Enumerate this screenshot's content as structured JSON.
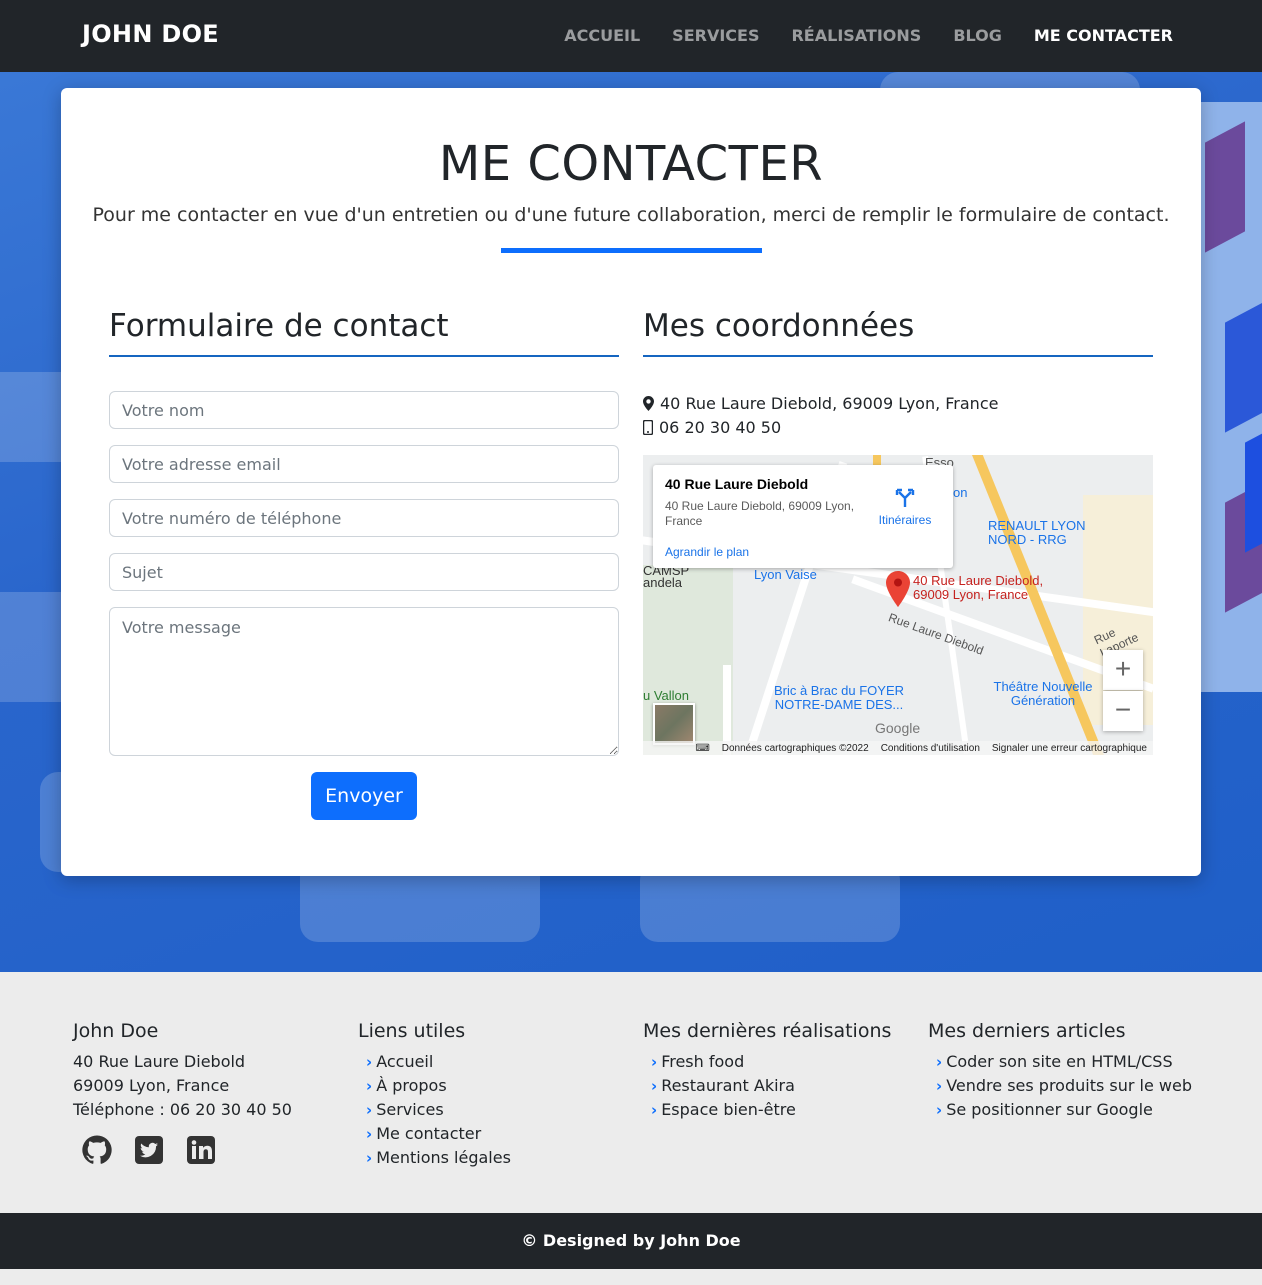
{
  "nav": {
    "brand": "JOHN DOE",
    "links": [
      "ACCUEIL",
      "SERVICES",
      "RÉALISATIONS",
      "BLOG",
      "ME CONTACTER"
    ]
  },
  "page": {
    "title": "ME CONTACTER",
    "subtitle": "Pour me contacter en vue d'un entretien ou d'une future collaboration, merci de remplir le formulaire de contact."
  },
  "form": {
    "heading": "Formulaire de contact",
    "name_placeholder": "Votre nom",
    "email_placeholder": "Votre adresse email",
    "phone_placeholder": "Votre numéro de téléphone",
    "subject_placeholder": "Sujet",
    "message_placeholder": "Votre message",
    "submit_label": "Envoyer"
  },
  "coords": {
    "heading": "Mes coordonnées",
    "address": "40 Rue Laure Diebold, 69009 Lyon, France",
    "phone": "06 20 30 40 50"
  },
  "map": {
    "info_title": "40 Rue Laure Diebold",
    "info_address": "40 Rue Laure Diebold, 69009 Lyon, France",
    "directions_label": "Itinéraires",
    "enlarge_label": "Agrandir le plan",
    "labels": {
      "esso": "Esso",
      "renault": "RENAULT LYON NORD - RRG",
      "lyon_vaise": "Lyon Vaise",
      "pin": "40 Rue Laure Diebold, 69009 Lyon, France",
      "camsp": "CAMSP",
      "andela": "andela",
      "rue_laure": "Rue Laure Diebold",
      "rue_laporte": "Rue Laporte",
      "vallon": "u Vallon",
      "bric": "Bric à Brac du FOYER NOTRE-DAME DES...",
      "theatre": "Théâtre Nouvelle Génération",
      "google": "Google",
      "on": "on"
    },
    "zoom_in": "+",
    "zoom_out": "−",
    "footer": [
      "Données cartographiques ©2022",
      "Conditions d'utilisation",
      "Signaler une erreur cartographique"
    ]
  },
  "footer": {
    "col1": {
      "heading": "John Doe",
      "line1": "40 Rue Laure Diebold",
      "line2": "69009 Lyon, France",
      "line3": "Téléphone : 06 20 30 40 50",
      "socials": [
        "github-icon",
        "twitter-icon",
        "linkedin-icon"
      ]
    },
    "col2": {
      "heading": "Liens utiles",
      "links": [
        "Accueil",
        "À propos",
        "Services",
        "Me contacter",
        "Mentions légales"
      ]
    },
    "col3": {
      "heading": "Mes dernières réalisations",
      "links": [
        "Fresh food",
        "Restaurant Akira",
        "Espace bien-être"
      ]
    },
    "col4": {
      "heading": "Mes derniers articles",
      "links": [
        "Coder son site en HTML/CSS",
        "Vendre ses produits sur le web",
        "Se positionner sur Google"
      ]
    },
    "copyright": "© Designed by John Doe"
  },
  "colors": {
    "accent": "#0d6efd",
    "dark": "#212529",
    "hero": "#2a66cc"
  }
}
